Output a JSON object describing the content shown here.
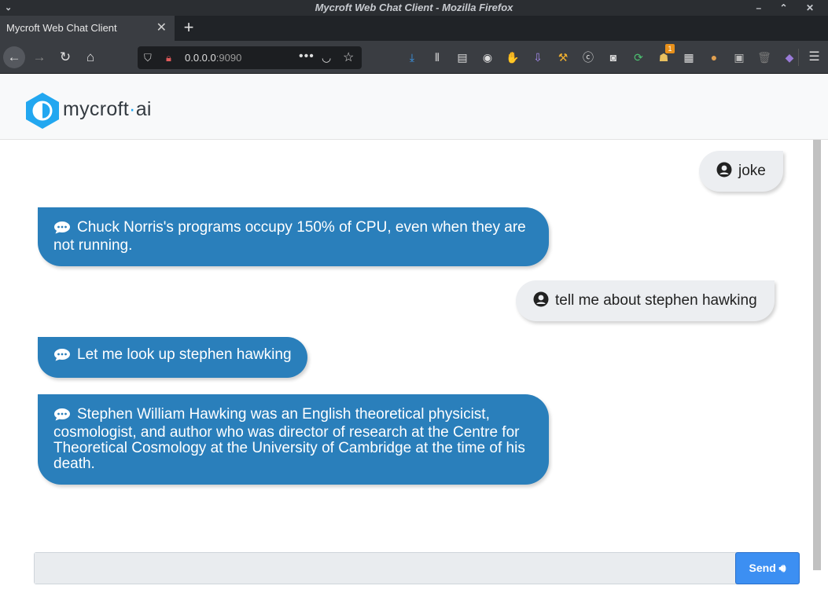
{
  "window": {
    "title": "Mycroft Web Chat Client - Mozilla Firefox",
    "controls": "– ⌃ ✕"
  },
  "tabs": [
    {
      "label": "Mycroft Web Chat Client",
      "active": true
    }
  ],
  "urlbar": {
    "host": "0.0.0.0",
    "port": ":9090"
  },
  "toolbar_icons": [
    "download-icon",
    "library-icon",
    "sidebar-icon",
    "account-icon",
    "extension-icon",
    "download-arrow-icon",
    "broom-icon",
    "circle-c-icon",
    "glasses-icon",
    "sync-icon",
    "hat-icon",
    "reader-icon",
    "cookie-icon",
    "lastfm-icon",
    "trash-icon",
    "privacy-icon"
  ],
  "toolbar_badge": "1",
  "brand": {
    "name_left": "mycroft",
    "dot": "·",
    "name_right": "ai",
    "accent": "#22a7f0"
  },
  "messages": [
    {
      "role": "user",
      "text": "joke"
    },
    {
      "role": "bot",
      "text": "Chuck Norris's programs occupy 150% of CPU, even when they are not running."
    },
    {
      "role": "user",
      "text": "tell me about stephen hawking"
    },
    {
      "role": "bot",
      "text": "Let me look up stephen hawking"
    },
    {
      "role": "bot",
      "text": "Stephen William Hawking was an English theoretical physicist, cosmologist, and author who was director of research at the Centre for Theoretical Cosmology at the University of Cambridge at the time of his death."
    }
  ],
  "composer": {
    "value": "",
    "send_label": "Send"
  },
  "colors": {
    "bot_bubble": "#2a7fbb",
    "user_bubble": "#eceef1",
    "send_button": "#3c8ff2"
  }
}
